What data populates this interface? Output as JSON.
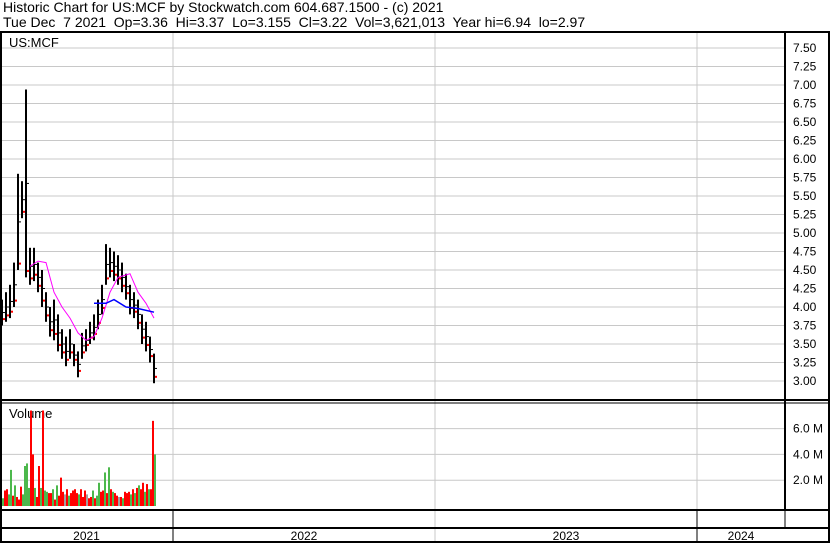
{
  "header": {
    "line1": "Historic Chart for US:MCF by Stockwatch.com 604.687.1500 - (c) 2021",
    "line2": "Tue Dec  7 2021  Op=3.36  Hi=3.37  Lo=3.155  Cl=3.22  Vol=3,621,013  Year hi=6.94  lo=2.97"
  },
  "chart_data": {
    "type": "ohlc",
    "symbol_label": "US:MCF",
    "price_ticks": [
      "7.50",
      "7.25",
      "7.00",
      "6.75",
      "6.50",
      "6.25",
      "6.00",
      "5.75",
      "5.50",
      "5.25",
      "5.00",
      "4.75",
      "4.50",
      "4.25",
      "4.00",
      "3.75",
      "3.50",
      "3.25",
      "3.00"
    ],
    "price_range": [
      2.8,
      7.65
    ],
    "volume_label": "Volume",
    "volume_ticks": [
      "6.0 M",
      "4.0 M",
      "2.0 M"
    ],
    "volume_tick_values_m": [
      6,
      4,
      2
    ],
    "x_labels": [
      "2021",
      "2022",
      "2023",
      "2024"
    ],
    "bars_hi_lo": [
      [
        4.1,
        3.75
      ],
      [
        4.2,
        3.8
      ],
      [
        4.3,
        3.85
      ],
      [
        4.6,
        4.0
      ],
      [
        5.8,
        4.5
      ],
      [
        5.7,
        5.2
      ],
      [
        6.94,
        4.4
      ],
      [
        4.8,
        4.3
      ],
      [
        4.8,
        4.35
      ],
      [
        4.6,
        4.2
      ],
      [
        4.5,
        4.0
      ],
      [
        4.2,
        3.8
      ],
      [
        4.0,
        3.6
      ],
      [
        4.1,
        3.55
      ],
      [
        3.9,
        3.4
      ],
      [
        3.7,
        3.3
      ],
      [
        3.6,
        3.2
      ],
      [
        3.7,
        3.3
      ],
      [
        3.5,
        3.2
      ],
      [
        3.4,
        3.05
      ],
      [
        3.65,
        3.3
      ],
      [
        3.7,
        3.4
      ],
      [
        3.8,
        3.5
      ],
      [
        3.9,
        3.55
      ],
      [
        4.1,
        3.7
      ],
      [
        4.3,
        3.9
      ],
      [
        4.85,
        4.3
      ],
      [
        4.8,
        4.4
      ],
      [
        4.75,
        4.35
      ],
      [
        4.7,
        4.3
      ],
      [
        4.6,
        4.2
      ],
      [
        4.45,
        4.1
      ],
      [
        4.3,
        3.9
      ],
      [
        4.2,
        3.85
      ],
      [
        4.1,
        3.7
      ],
      [
        3.9,
        3.5
      ],
      [
        3.8,
        3.4
      ],
      [
        3.6,
        3.25
      ],
      [
        3.37,
        2.97
      ]
    ],
    "last_close": 3.22,
    "ma_short": [
      [
        7,
        4.55
      ],
      [
        9,
        4.62
      ],
      [
        11,
        4.6
      ],
      [
        13,
        4.2
      ],
      [
        15,
        4.0
      ],
      [
        17,
        3.85
      ],
      [
        19,
        3.65
      ],
      [
        21,
        3.55
      ],
      [
        23,
        3.6
      ],
      [
        25,
        3.85
      ],
      [
        27,
        4.2
      ],
      [
        29,
        4.4
      ],
      [
        32,
        4.45
      ],
      [
        34,
        4.2
      ],
      [
        36,
        4.05
      ],
      [
        38,
        3.85
      ]
    ],
    "ma_long": [
      [
        23,
        4.05
      ],
      [
        26,
        4.05
      ],
      [
        28,
        4.1
      ],
      [
        31,
        4.0
      ],
      [
        34,
        3.98
      ],
      [
        38,
        3.93
      ]
    ],
    "volume_m": [
      0.6,
      1.2,
      1.3,
      0.9,
      2.8,
      0.8,
      1.6,
      0.7,
      0.5,
      1.5,
      0.9,
      3.1,
      3.3,
      1.4,
      7.4,
      4.0,
      1.4,
      0.7,
      3.1,
      1.4,
      7.4,
      1.2,
      1.1,
      1.0,
      1.0,
      1.3,
      0.5,
      1.6,
      0.8,
      2.2,
      1.1,
      0.9,
      1.3,
      0.8,
      1.0,
      1.2,
      1.3,
      1.0,
      0.9,
      1.3,
      0.7,
      1.2,
      0.9,
      0.6,
      0.7,
      1.2,
      0.6,
      0.8,
      1.8,
      1.1,
      1.2,
      2.6,
      1.0,
      3.0,
      1.3,
      1.1,
      1.0,
      0.8,
      0.7,
      0.7,
      0.6,
      1.1,
      1.0,
      1.1,
      0.9,
      1.3,
      1.0,
      1.4,
      1.6,
      1.3,
      1.8,
      1.1,
      1.7,
      1.3,
      1.3,
      6.6,
      4.0
    ],
    "volume_colors": [
      "g",
      "r",
      "r",
      "g",
      "g",
      "r",
      "g",
      "r",
      "r",
      "r",
      "g",
      "g",
      "g",
      "g",
      "r",
      "r",
      "g",
      "r",
      "r",
      "g",
      "r",
      "g",
      "g",
      "r",
      "r",
      "g",
      "r",
      "g",
      "r",
      "r",
      "r",
      "x",
      "r",
      "g",
      "r",
      "r",
      "r",
      "r",
      "g",
      "r",
      "r",
      "r",
      "x",
      "r",
      "r",
      "g",
      "r",
      "g",
      "g",
      "r",
      "r",
      "g",
      "r",
      "g",
      "r",
      "g",
      "r",
      "r",
      "x",
      "r",
      "g",
      "r",
      "r",
      "r",
      "g",
      "r",
      "g",
      "r",
      "g",
      "r",
      "r",
      "g",
      "r",
      "g",
      "r",
      "r",
      "g"
    ]
  }
}
